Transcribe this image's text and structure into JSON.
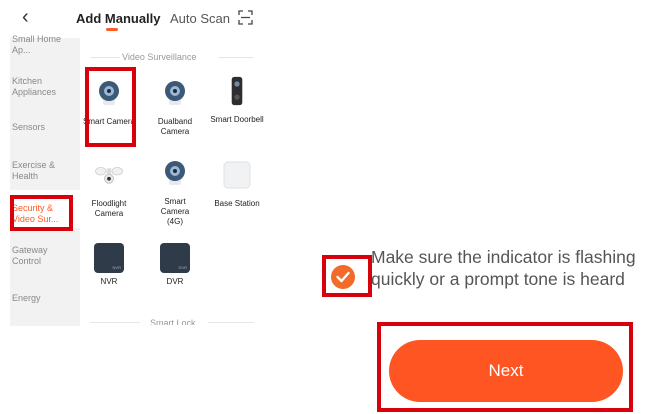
{
  "header": {
    "back_icon": "chevron-left-icon",
    "tabs": [
      {
        "label": "Add Manually",
        "active": true
      },
      {
        "label": "Auto Scan",
        "active": false
      }
    ],
    "scan_icon": "scan-icon"
  },
  "sidebar": {
    "items": [
      {
        "label": "Small Home Ap..."
      },
      {
        "label": "Kitchen Appliances"
      },
      {
        "label": "Sensors"
      },
      {
        "label": "Exercise & Health"
      },
      {
        "label": "Security & Video Sur...",
        "active": true
      },
      {
        "label": "Gateway Control"
      },
      {
        "label": "Energy"
      }
    ]
  },
  "main": {
    "section_video": "Video Surveillance",
    "devices": [
      {
        "label": "Smart Camera",
        "icon": "smart-camera-icon"
      },
      {
        "label": "Dualband Camera",
        "icon": "dualband-camera-icon"
      },
      {
        "label": "Smart Doorbell",
        "icon": "doorbell-icon"
      },
      {
        "label": "Floodlight Camera",
        "icon": "floodlight-camera-icon"
      },
      {
        "label": "Smart Camera (4G)",
        "icon": "camera-4g-icon"
      },
      {
        "label": "Base Station",
        "icon": "base-station-icon"
      },
      {
        "label": "NVR",
        "icon": "nvr-icon",
        "box_text": "NVR"
      },
      {
        "label": "DVR",
        "icon": "dvr-icon",
        "box_text": "DVR"
      }
    ],
    "section_lock": "Smart Lock"
  },
  "confirm": {
    "message": "Make sure the indicator is flashing quickly or a prompt tone is heard",
    "checked": true,
    "next_label": "Next"
  },
  "colors": {
    "accent": "#ff5a28",
    "highlight_box": "#d8000c",
    "check": "#f26b2a"
  }
}
